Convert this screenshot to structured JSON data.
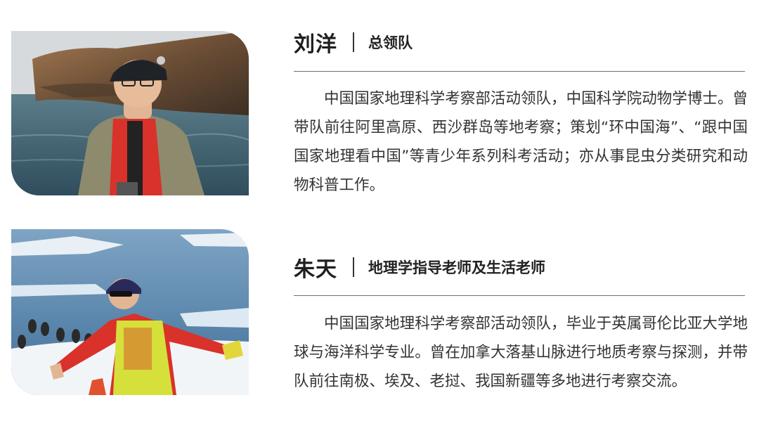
{
  "profiles": [
    {
      "name": "刘洋",
      "role": "总领队",
      "bio": "中国国家地理科学考察部活动领队，中国科学院动物学博士。曾带队前往阿里高原、西沙群岛等地考察；策划“环中国海”、“跟中国国家地理看中国”等青少年系列科考活动；亦从事昆虫分类研究和动物科普工作。",
      "photo_alt": "man in red life vest and cap by the sea"
    },
    {
      "name": "朱天",
      "role": "地理学指导老师及生活老师",
      "bio": "中国国家地理科学考察部活动领队，毕业于英属哥伦比亚大学地球与海洋科学专业。曾在加拿大落基山脉进行地质考察与探测，并带队前往南极、埃及、老挝、我国新疆等多地进行考察交流。",
      "photo_alt": "woman in red jacket and yellow vest in Antarctica with penguins"
    }
  ],
  "colors": {
    "text": "#333333",
    "rule": "#6f6f6f",
    "accent_red": "#d8322b"
  }
}
